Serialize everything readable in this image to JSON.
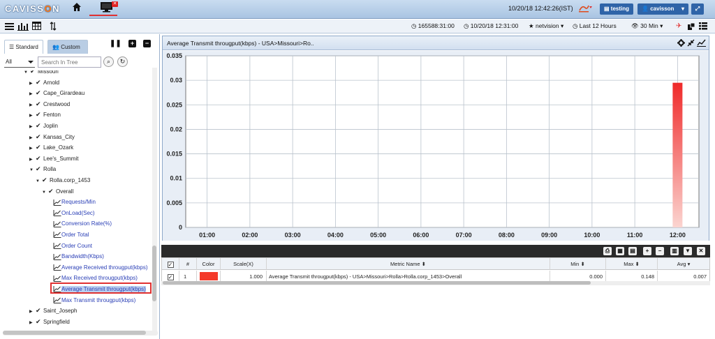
{
  "app": {
    "logo": "CAVISS",
    "logo_o": "O",
    "logo_end": "N"
  },
  "header": {
    "datetime": "10/20/18 12:42:26(IST)",
    "project_label": "testing",
    "user_label": "cavisson"
  },
  "toolbar": {
    "session": "165588:31:00",
    "time": "10/20/18 12:31:00",
    "profile": "netvision",
    "range": "Last 12 Hours",
    "interval": "30 Min"
  },
  "sidebar": {
    "tab_standard": "Standard",
    "tab_custom": "Custom",
    "filter_value": "All",
    "search_placeholder": "Search In Tree",
    "tree": [
      {
        "label": "Missouri",
        "type": "open",
        "level": 1
      },
      {
        "label": "Arnold",
        "type": "closed",
        "level": 2
      },
      {
        "label": "Cape_Girardeau",
        "type": "closed",
        "level": 2
      },
      {
        "label": "Crestwood",
        "type": "closed",
        "level": 2
      },
      {
        "label": "Fenton",
        "type": "closed",
        "level": 2
      },
      {
        "label": "Joplin",
        "type": "closed",
        "level": 2
      },
      {
        "label": "Kansas_City",
        "type": "closed",
        "level": 2
      },
      {
        "label": "Lake_Ozark",
        "type": "closed",
        "level": 2
      },
      {
        "label": "Lee's_Summit",
        "type": "closed",
        "level": 2
      },
      {
        "label": "Rolla",
        "type": "open",
        "level": 2
      },
      {
        "label": "Rolla.corp_1453",
        "type": "open",
        "level": 3
      },
      {
        "label": "Overall",
        "type": "open",
        "level": 4
      },
      {
        "label": "Requests/Min",
        "type": "leaf",
        "level": 5
      },
      {
        "label": "OnLoad(Sec)",
        "type": "leaf",
        "level": 5
      },
      {
        "label": "Conversion Rate(%)",
        "type": "leaf",
        "level": 5
      },
      {
        "label": "Order Total",
        "type": "leaf",
        "level": 5
      },
      {
        "label": "Order Count",
        "type": "leaf",
        "level": 5
      },
      {
        "label": "Bandwidth(Kbps)",
        "type": "leaf",
        "level": 5
      },
      {
        "label": "Average Received througput(kbps)",
        "type": "leaf",
        "level": 5
      },
      {
        "label": "Max Received througput(kbps)",
        "type": "leaf",
        "level": 5
      },
      {
        "label": "Average Transmit througput(kbps)",
        "type": "leaf",
        "level": 5,
        "selected": true
      },
      {
        "label": "Max Transmit througput(kbps)",
        "type": "leaf",
        "level": 5
      },
      {
        "label": "Saint_Joseph",
        "type": "closed",
        "level": 2
      },
      {
        "label": "Springfield",
        "type": "closed",
        "level": 2
      }
    ]
  },
  "chart_panel": {
    "title": "Average Transmit througput(kbps) - USA>Missouri>Ro.."
  },
  "chart_data": {
    "type": "bar",
    "categories": [
      "01:00",
      "02:00",
      "03:00",
      "04:00",
      "05:00",
      "06:00",
      "07:00",
      "08:00",
      "09:00",
      "10:00",
      "11:00",
      "12:00"
    ],
    "x_ticks": [
      "01:00",
      "02:00",
      "03:00",
      "04:00",
      "05:00",
      "06:00",
      "07:00",
      "08:00",
      "09:00",
      "10:00",
      "11:00",
      "12:00"
    ],
    "y_ticks": [
      "0",
      "0.005",
      "0.01",
      "0.015",
      "0.02",
      "0.025",
      "0.03",
      "0.035"
    ],
    "ylim": [
      0,
      0.035
    ],
    "bars": [
      {
        "x": "12:00",
        "value": 0.0295
      }
    ],
    "grid": true,
    "bar_color": "#ef2a2a"
  },
  "metrics_table": {
    "headers": {
      "num": "#",
      "color": "Color",
      "scale": "Scale(X)",
      "metric": "Metric Name",
      "min": "Min",
      "max": "Max",
      "avg": "Avg"
    },
    "rows": [
      {
        "num": "1",
        "color": "#f43a2a",
        "scale": "1.000",
        "metric": "Average Transmit througput(kbps) - USA>Missouri>Rolla>Rolla.corp_1453>Overall",
        "min": "0.000",
        "max": "0.148",
        "avg": "0.007"
      }
    ]
  }
}
